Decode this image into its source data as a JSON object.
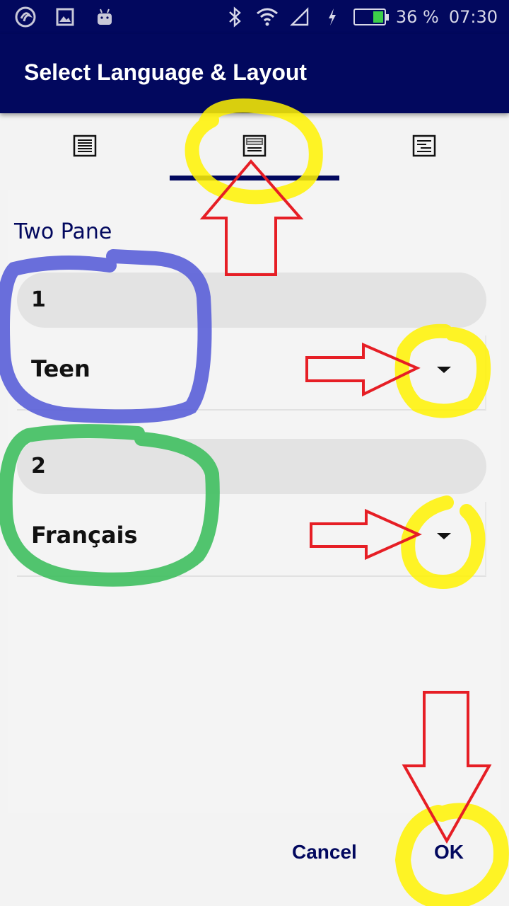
{
  "status_bar": {
    "battery_percent": "36 %",
    "time": "07:30",
    "battery_level": 0.36,
    "left_icons": [
      "app-logo-icon",
      "image-icon",
      "android-icon"
    ],
    "right_icons": [
      "bluetooth-icon",
      "wifi-icon",
      "signal-icon",
      "charging-icon",
      "battery-icon"
    ]
  },
  "dialog": {
    "title": "Select Language & Layout",
    "tabs": [
      {
        "icon": "single-pane-layout-icon",
        "selected": false
      },
      {
        "icon": "two-pane-layout-icon",
        "selected": true
      },
      {
        "icon": "interlinear-layout-icon",
        "selected": false
      }
    ],
    "section_title": "Two Pane",
    "panes": [
      {
        "number": "1",
        "language": "Teen"
      },
      {
        "number": "2",
        "language": "Français"
      }
    ],
    "cancel_label": "Cancel",
    "ok_label": "OK"
  },
  "colors": {
    "primary": "#02085e",
    "annotation_yellow": "#fff200",
    "annotation_red": "#e61e25",
    "annotation_blue": "#5a5fd8",
    "annotation_green": "#3fbf5f"
  }
}
